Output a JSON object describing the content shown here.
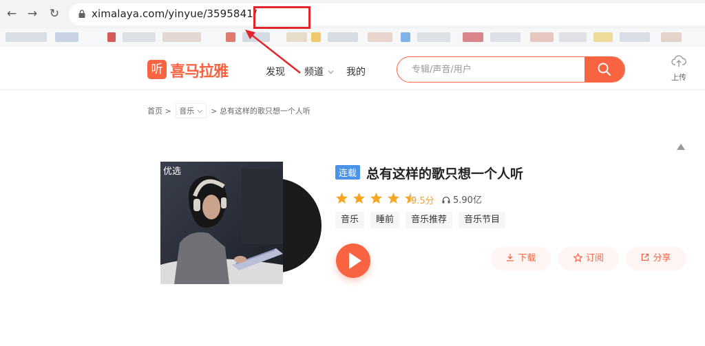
{
  "browser": {
    "back_glyph": "←",
    "forward_glyph": "→",
    "reload_glyph": "↻",
    "url": "ximalaya.com/yinyue/3595841/"
  },
  "header": {
    "logo_glyph": "听",
    "logo_text": "喜马拉雅",
    "nav": [
      {
        "label": "发现"
      },
      {
        "label": "频道"
      },
      {
        "label": "我的"
      }
    ],
    "search_placeholder": "专辑/声音/用户",
    "upload_label": "上传"
  },
  "breadcrumb": {
    "home": "首页",
    "sep": ">",
    "category": "音乐",
    "current": "总有这样的歌只想一个人听"
  },
  "album": {
    "cover_badge": "优选",
    "status_badge": "连载",
    "title": "总有这样的歌只想一个人听",
    "rating_stars": 4.5,
    "score": "9.5分",
    "plays": "5.90亿",
    "tags": [
      "音乐",
      "睡前",
      "音乐推荐",
      "音乐节目"
    ],
    "actions": {
      "download": "下载",
      "subscribe": "订阅",
      "share": "分享"
    }
  },
  "colors": {
    "brand": "#f86442",
    "badge_blue": "#4b93e8",
    "star": "#f5a623",
    "highlight_red": "#e0262b"
  }
}
